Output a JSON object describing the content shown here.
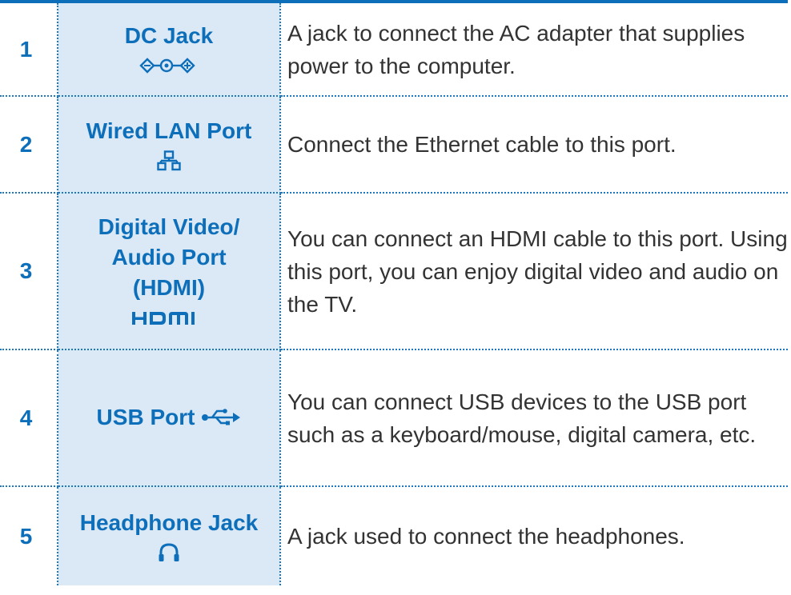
{
  "ports": [
    {
      "number": "1",
      "name_lines": [
        "DC Jack"
      ],
      "icon": "dc-jack-icon",
      "description": "A jack to connect the AC adapter that supplies power to the computer."
    },
    {
      "number": "2",
      "name_lines": [
        "Wired LAN Port"
      ],
      "icon": "lan-port-icon",
      "description": "Connect the Ethernet cable to this port."
    },
    {
      "number": "3",
      "name_lines": [
        "Digital Video/",
        "Audio Port",
        "(HDMI)"
      ],
      "icon": "hdmi-icon",
      "icon_text": "HDMI",
      "description": "You can connect an HDMI cable to this port. Using this port, you can enjoy digital video and audio on the TV."
    },
    {
      "number": "4",
      "name_lines": [
        "USB Port"
      ],
      "icon": "usb-icon",
      "description": "You can connect USB devices to the USB port such as a keyboard/mouse, digital camera, etc."
    },
    {
      "number": "5",
      "name_lines": [
        "Headphone Jack"
      ],
      "icon": "headphone-icon",
      "description": "A jack used to connect the headphones."
    }
  ],
  "colors": {
    "accent": "#0d6fba",
    "name_cell_bg": "#dbe8f5",
    "body_text": "#333333",
    "divider": "#1d78bd"
  }
}
